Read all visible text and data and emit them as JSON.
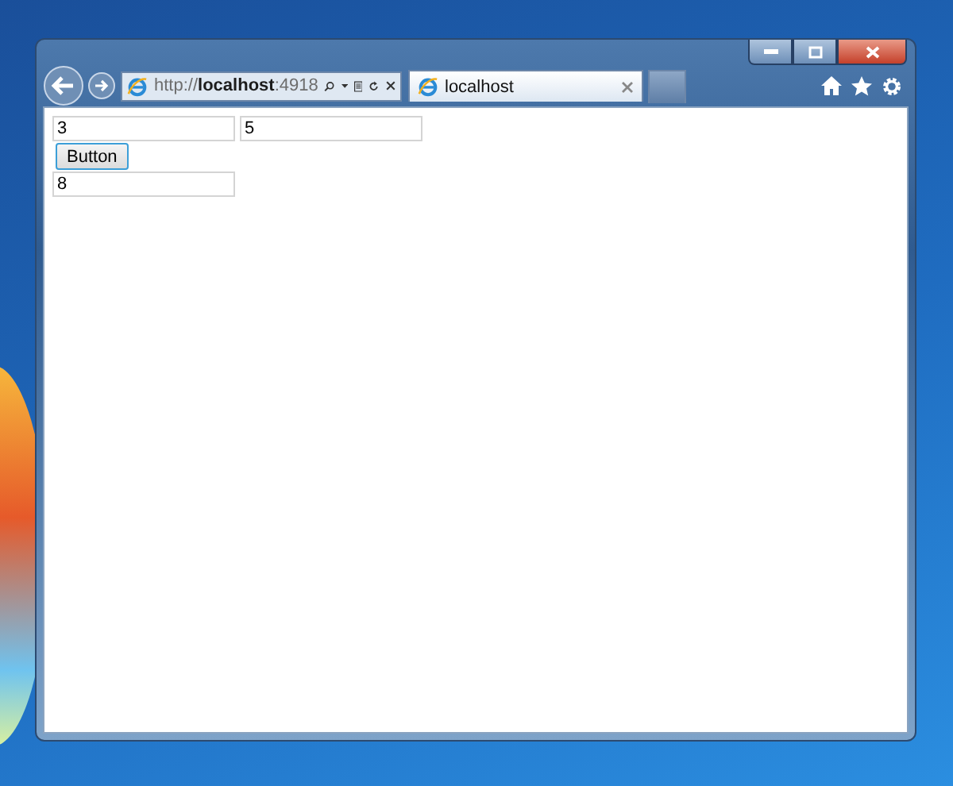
{
  "browser": {
    "address": "http://**localhost**:4918",
    "tabs": [
      {
        "label": "localhost",
        "selected": true
      }
    ]
  },
  "page": {
    "fields": [
      {
        "value": "3"
      },
      {
        "value": "5"
      }
    ],
    "button": "Button",
    "result": {
      "value": "8"
    }
  }
}
